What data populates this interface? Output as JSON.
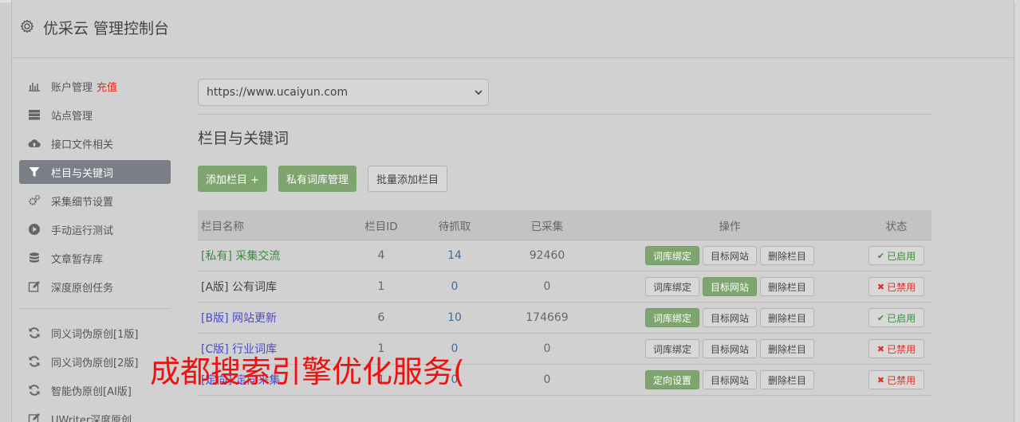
{
  "header": {
    "title": "优采云 管理控制台",
    "icon": "gear-icon"
  },
  "sidebar": {
    "items": [
      {
        "label": "账户管理",
        "extra": "充值",
        "icon": "bar-chart-icon"
      },
      {
        "label": "站点管理",
        "icon": "server-icon"
      },
      {
        "label": "接口文件相关",
        "icon": "cloud-upload-icon"
      },
      {
        "label": "栏目与关键词",
        "icon": "filter-icon",
        "active": true
      },
      {
        "label": "采集细节设置",
        "icon": "cogs-icon"
      },
      {
        "label": "手动运行测试",
        "icon": "play-circle-icon"
      },
      {
        "label": "文章暂存库",
        "icon": "database-icon"
      },
      {
        "label": "深度原创任务",
        "icon": "edit-icon"
      }
    ],
    "items2": [
      {
        "label": "同义词伪原创[1版]",
        "icon": "refresh-icon"
      },
      {
        "label": "同义词伪原创[2版]",
        "icon": "refresh-icon"
      },
      {
        "label": "智能伪原创[AI版]",
        "icon": "refresh-icon"
      },
      {
        "label": "UWriter深度原创",
        "icon": "edit-icon"
      }
    ]
  },
  "main": {
    "site_select": "https://www.ucaiyun.com",
    "section_title": "栏目与关键词",
    "buttons": {
      "add": "添加栏目 +",
      "private": "私有词库管理",
      "batch": "批量添加栏目"
    }
  },
  "table": {
    "headers": {
      "name": "栏目名称",
      "id": "栏目ID",
      "pending": "待抓取",
      "done": "已采集",
      "ops": "操作",
      "status": "状态"
    },
    "rows": [
      {
        "name": "[私有] 采集交流",
        "id": "4",
        "pending": "14",
        "done": "92460",
        "op1": "词库绑定",
        "op2": "目标网站",
        "op3": "删除栏目",
        "status": "已启用"
      },
      {
        "name": "[A版] 公有词库",
        "id": "1",
        "pending": "0",
        "done": "0",
        "op1": "词库绑定",
        "op2": "目标网站",
        "op3": "删除栏目",
        "status": "已禁用"
      },
      {
        "name": "[B版] 网站更新",
        "id": "6",
        "pending": "10",
        "done": "174669",
        "op1": "词库绑定",
        "op2": "目标网站",
        "op3": "删除栏目",
        "status": "已启用"
      },
      {
        "name": "[C版] 行业词库",
        "id": "1",
        "pending": "0",
        "done": "0",
        "op1": "词库绑定",
        "op2": "目标网站",
        "op3": "删除栏目",
        "status": "已禁用"
      },
      {
        "name": "[定向] 定向采集",
        "id": "1",
        "pending": "0",
        "done": "0",
        "op1": "定向设置",
        "op2": "目标网站",
        "op3": "删除栏目",
        "status": "已禁用"
      }
    ]
  },
  "overlay": {
    "text": "成都搜索引擎优化服务("
  },
  "colors": {
    "green": "#7ea56e",
    "active_sidebar": "#7a7e87",
    "danger": "#d9322e",
    "link_blue": "#4a4acc",
    "overlay_red": "#f01010"
  }
}
